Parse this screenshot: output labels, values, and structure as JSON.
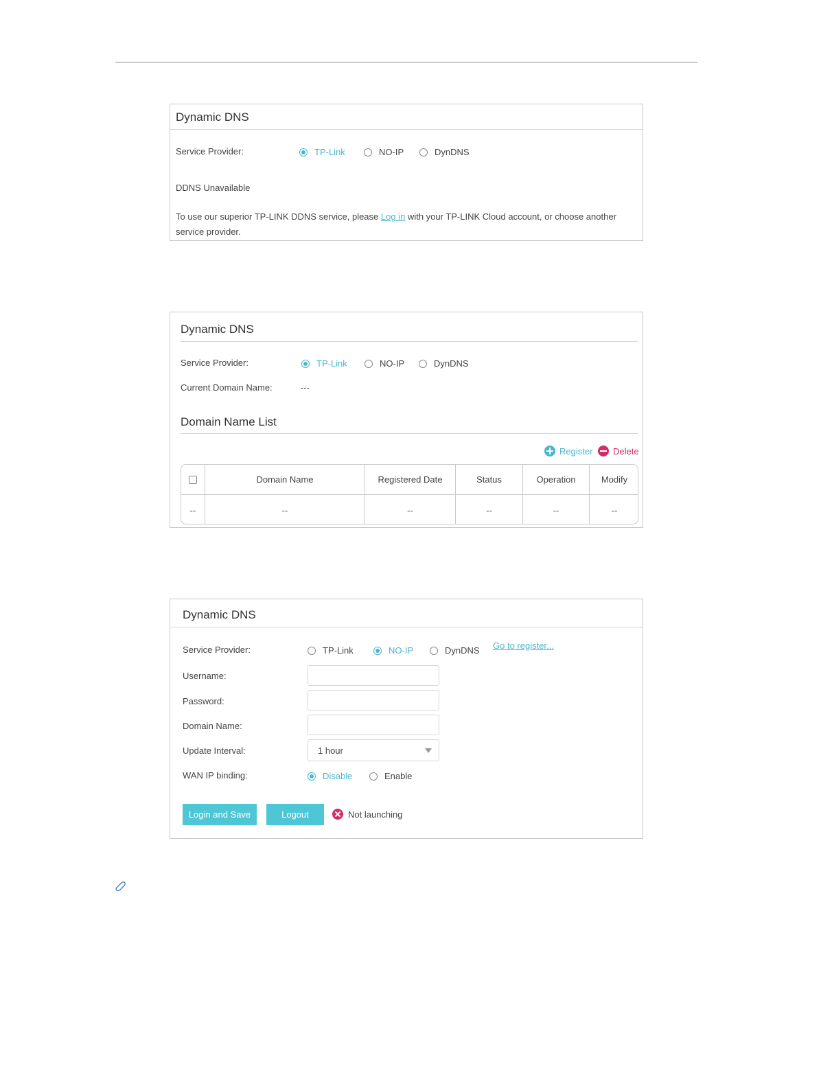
{
  "panel1": {
    "title": "Dynamic DNS",
    "service_provider_label": "Service Provider:",
    "providers": [
      "TP-Link",
      "NO-IP",
      "DynDNS"
    ],
    "selected_provider": "TP-Link",
    "status": "DDNS Unavailable",
    "message_before_link": "To use our superior TP-LINK DDNS service, please ",
    "login_link": "Log in",
    "message_after_link": " with your TP-LINK Cloud account, or choose another",
    "message_line2": "service provider."
  },
  "panel2": {
    "title": "Dynamic DNS",
    "service_provider_label": "Service Provider:",
    "providers": [
      "TP-Link",
      "NO-IP",
      "DynDNS"
    ],
    "selected_provider": "TP-Link",
    "current_domain_label": "Current Domain Name:",
    "current_domain_value": "---",
    "list_title": "Domain Name List",
    "register_label": "Register",
    "delete_label": "Delete",
    "table": {
      "columns": [
        "Domain Name",
        "Registered Date",
        "Status",
        "Operation",
        "Modify"
      ],
      "rows": [
        [
          "--",
          "--",
          "--",
          "--",
          "--",
          "--"
        ]
      ]
    }
  },
  "panel3": {
    "title": "Dynamic DNS",
    "service_provider_label": "Service Provider:",
    "providers": [
      "TP-Link",
      "NO-IP",
      "DynDNS"
    ],
    "selected_provider": "NO-IP",
    "register_link": "Go to register...",
    "username_label": "Username:",
    "username_value": "",
    "password_label": "Password:",
    "password_value": "",
    "domain_label": "Domain Name:",
    "domain_value": "",
    "interval_label": "Update Interval:",
    "interval_value": "1 hour",
    "wan_label": "WAN IP binding:",
    "wan_options": [
      "Disable",
      "Enable"
    ],
    "wan_selected": "Disable",
    "login_save_label": "Login and Save",
    "logout_label": "Logout",
    "status_text": "Not launching"
  },
  "colors": {
    "accent": "#4ab6cb",
    "button": "#4dc7d6",
    "danger": "#d02e6a"
  },
  "icons": [
    "plus-circle-icon",
    "minus-circle-icon",
    "error-x-icon",
    "paperclip-icon",
    "chevron-down-icon"
  ]
}
